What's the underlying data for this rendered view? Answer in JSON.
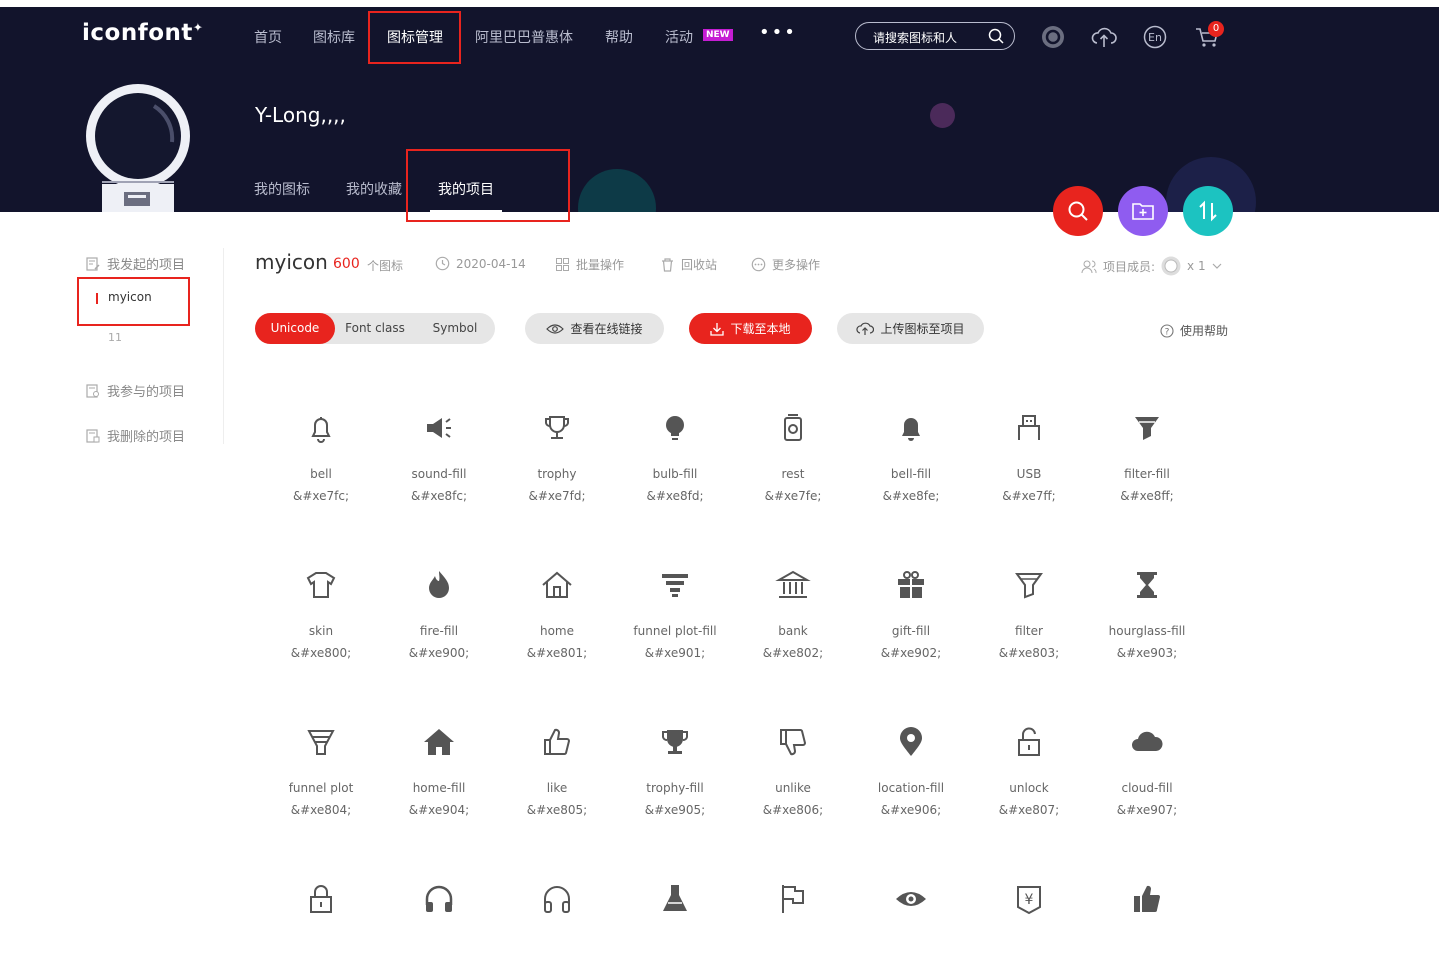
{
  "header": {
    "logo": "iconfont",
    "nav": [
      "首页",
      "图标库",
      "图标管理",
      "阿里巴巴普惠体",
      "帮助",
      "活动"
    ],
    "new_badge": "NEW",
    "more": "•••",
    "search_placeholder": "请搜索图标和人",
    "cart_count": "0"
  },
  "profile": {
    "username": "Y-Long,,,,",
    "tabs": [
      "我的图标",
      "我的收藏",
      "我的项目"
    ]
  },
  "sidebar": {
    "initiated": "我发起的项目",
    "current_project": "myicon",
    "count": "11",
    "participated": "我参与的项目",
    "deleted": "我删除的项目"
  },
  "project": {
    "title": "myicon",
    "count": "600",
    "count_unit": "个图标",
    "date": "2020-04-14",
    "batch": "批量操作",
    "recycle": "回收站",
    "more_ops": "更多操作",
    "members_label": "项目成员:",
    "members_count": "x 1"
  },
  "toolbar": {
    "modes": [
      "Unicode",
      "Font class",
      "Symbol"
    ],
    "view_link": "查看在线链接",
    "download": "下载至本地",
    "upload": "上传图标至项目",
    "help": "使用帮助"
  },
  "icons": [
    {
      "name": "bell",
      "code": "&#xe7fc;",
      "icon": "bell-icon"
    },
    {
      "name": "sound-fill",
      "code": "&#xe8fc;",
      "icon": "sound-fill-icon"
    },
    {
      "name": "trophy",
      "code": "&#xe7fd;",
      "icon": "trophy-icon"
    },
    {
      "name": "bulb-fill",
      "code": "&#xe8fd;",
      "icon": "bulb-fill-icon"
    },
    {
      "name": "rest",
      "code": "&#xe7fe;",
      "icon": "rest-icon"
    },
    {
      "name": "bell-fill",
      "code": "&#xe8fe;",
      "icon": "bell-fill-icon"
    },
    {
      "name": "USB",
      "code": "&#xe7ff;",
      "icon": "usb-icon"
    },
    {
      "name": "filter-fill",
      "code": "&#xe8ff;",
      "icon": "filter-fill-icon"
    },
    {
      "name": "skin",
      "code": "&#xe800;",
      "icon": "skin-icon"
    },
    {
      "name": "fire-fill",
      "code": "&#xe900;",
      "icon": "fire-fill-icon"
    },
    {
      "name": "home",
      "code": "&#xe801;",
      "icon": "home-icon"
    },
    {
      "name": "funnel plot-fill",
      "code": "&#xe901;",
      "icon": "funnel-plot-fill-icon"
    },
    {
      "name": "bank",
      "code": "&#xe802;",
      "icon": "bank-icon"
    },
    {
      "name": "gift-fill",
      "code": "&#xe902;",
      "icon": "gift-fill-icon"
    },
    {
      "name": "filter",
      "code": "&#xe803;",
      "icon": "filter-icon"
    },
    {
      "name": "hourglass-fill",
      "code": "&#xe903;",
      "icon": "hourglass-fill-icon"
    },
    {
      "name": "funnel plot",
      "code": "&#xe804;",
      "icon": "funnel-plot-icon"
    },
    {
      "name": "home-fill",
      "code": "&#xe904;",
      "icon": "home-fill-icon"
    },
    {
      "name": "like",
      "code": "&#xe805;",
      "icon": "like-icon"
    },
    {
      "name": "trophy-fill",
      "code": "&#xe905;",
      "icon": "trophy-fill-icon"
    },
    {
      "name": "unlike",
      "code": "&#xe806;",
      "icon": "unlike-icon"
    },
    {
      "name": "location-fill",
      "code": "&#xe906;",
      "icon": "location-fill-icon"
    },
    {
      "name": "unlock",
      "code": "&#xe807;",
      "icon": "unlock-icon"
    },
    {
      "name": "cloud-fill",
      "code": "&#xe907;",
      "icon": "cloud-fill-icon"
    },
    {
      "name": "",
      "code": "",
      "icon": "lock-icon"
    },
    {
      "name": "",
      "code": "",
      "icon": "headphones-fill-icon"
    },
    {
      "name": "",
      "code": "",
      "icon": "headphones-icon"
    },
    {
      "name": "",
      "code": "",
      "icon": "flask-icon"
    },
    {
      "name": "",
      "code": "",
      "icon": "flag-icon"
    },
    {
      "name": "",
      "code": "",
      "icon": "eye-fill-icon"
    },
    {
      "name": "",
      "code": "",
      "icon": "yen-icon"
    },
    {
      "name": "",
      "code": "",
      "icon": "like-fill-icon"
    }
  ],
  "colors": {
    "brand_red": "#e8241e",
    "hero_bg": "#12142c",
    "purple": "#8f5cf0",
    "teal": "#1cc3c1"
  }
}
